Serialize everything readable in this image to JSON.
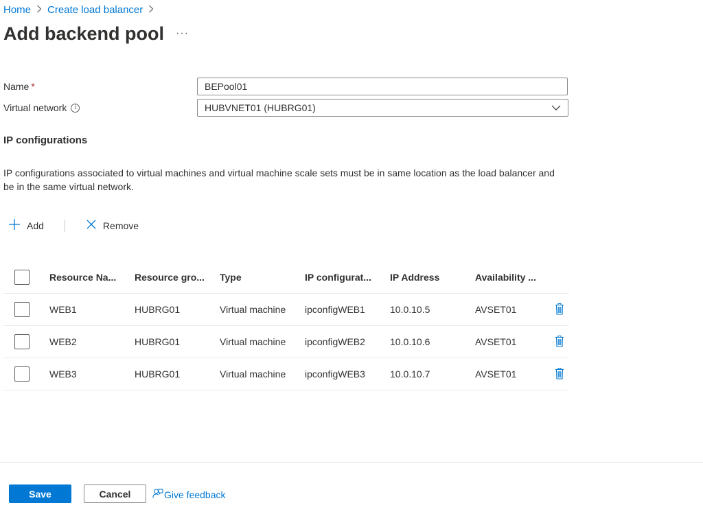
{
  "breadcrumb": {
    "items": [
      "Home",
      "Create load balancer"
    ]
  },
  "title": "Add backend pool",
  "more_label": "···",
  "form": {
    "name_label": "Name",
    "required_marker": "*",
    "name_value": "BEPool01",
    "vnet_label": "Virtual network",
    "info_glyph": "i",
    "vnet_value": "HUBVNET01 (HUBRG01)"
  },
  "section": {
    "title": "IP configurations",
    "description": "IP configurations associated to virtual machines and virtual machine scale sets must be in same location as the load balancer and be in the same virtual network."
  },
  "toolbar": {
    "add_label": "Add",
    "remove_label": "Remove"
  },
  "table": {
    "columns": [
      "Resource Na...",
      "Resource gro...",
      "Type",
      "IP configurat...",
      "IP Address",
      "Availability ..."
    ],
    "rows": [
      [
        "WEB1",
        "HUBRG01",
        "Virtual machine",
        "ipconfigWEB1",
        "10.0.10.5",
        "AVSET01"
      ],
      [
        "WEB2",
        "HUBRG01",
        "Virtual machine",
        "ipconfigWEB2",
        "10.0.10.6",
        "AVSET01"
      ],
      [
        "WEB3",
        "HUBRG01",
        "Virtual machine",
        "ipconfigWEB3",
        "10.0.10.7",
        "AVSET01"
      ]
    ]
  },
  "footer": {
    "save_label": "Save",
    "cancel_label": "Cancel",
    "feedback_label": "Give feedback"
  },
  "icons": {
    "add": "plus-icon",
    "remove": "close-icon",
    "delete": "trash-icon",
    "dropdown": "chevron-down-icon",
    "feedback": "feedback-person-icon",
    "info": "info-icon"
  },
  "colors": {
    "accent": "#0078d4",
    "required": "#a4262c",
    "text": "#323130"
  }
}
